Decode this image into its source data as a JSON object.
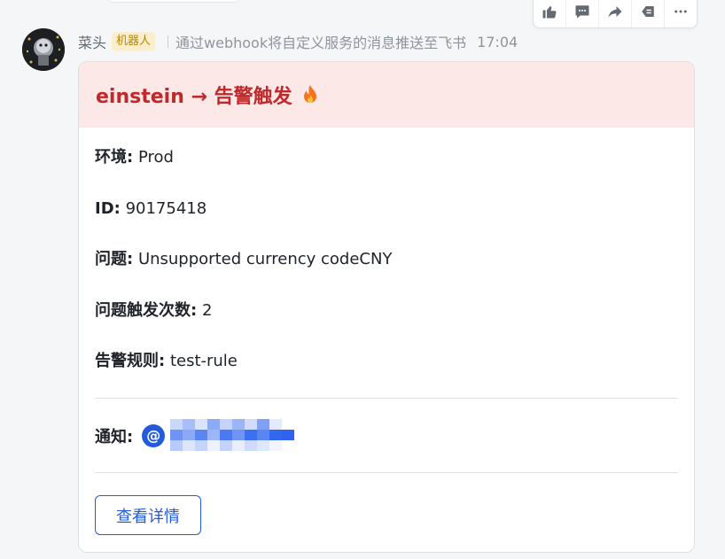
{
  "message": {
    "sender": "菜头",
    "bot_tag": "机器人",
    "description": "通过webhook将自定义服务的消息推送至飞书",
    "time": "17:04"
  },
  "actions": [
    {
      "icon": "thumbs-up-icon"
    },
    {
      "icon": "comment-icon"
    },
    {
      "icon": "forward-icon"
    },
    {
      "icon": "quote-reply-icon"
    },
    {
      "icon": "more-icon"
    }
  ],
  "card": {
    "title": "einstein → 告警触发",
    "title_icon": "fire-icon",
    "header_bg": "#fde8e8",
    "title_color": "#c0282a",
    "fields": [
      {
        "key": "环境:",
        "value": "Prod"
      },
      {
        "key": "ID:",
        "value": "90175418"
      },
      {
        "key": "问题:",
        "value": "Unsupported currency codeCNY"
      },
      {
        "key": "问题触发次数:",
        "value": "2"
      },
      {
        "key": "告警规则:",
        "value": "test-rule"
      }
    ],
    "notify_label": "通知:",
    "mention_prefix": "@",
    "button_label": "查看详情",
    "accent": "#245bdb"
  }
}
